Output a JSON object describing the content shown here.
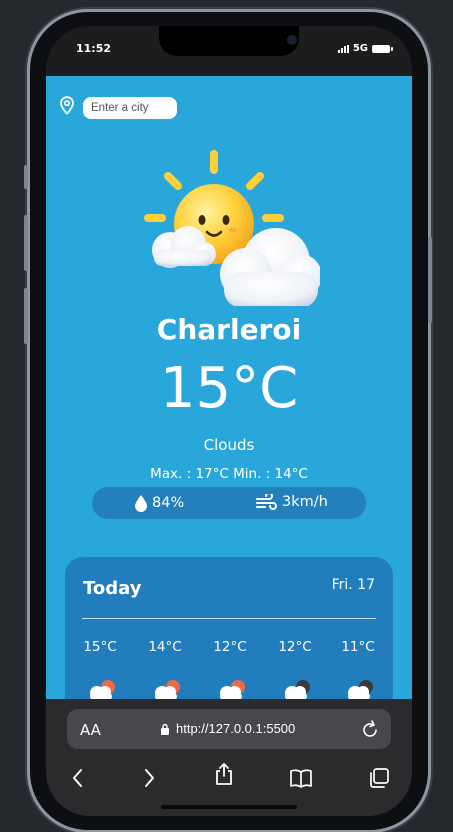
{
  "status_bar": {
    "time": "11:52",
    "network": "5G"
  },
  "search": {
    "placeholder": "Enter a city",
    "icon": "location-pin-icon"
  },
  "current": {
    "city": "Charleroi",
    "temperature": "15°C",
    "description": "Clouds",
    "max_min": "Max. : 17°C Min. : 14°C",
    "humidity": "84%",
    "wind": "3km/h",
    "weather_icon": "partly-cloudy-sun-icon"
  },
  "forecast": {
    "title": "Today",
    "date": "Fri. 17",
    "hours": [
      {
        "temp": "15°C",
        "icon": "cloud-sun-icon"
      },
      {
        "temp": "14°C",
        "icon": "cloud-sun-icon"
      },
      {
        "temp": "12°C",
        "icon": "cloud-sun-icon"
      },
      {
        "temp": "12°C",
        "icon": "cloud-moon-icon"
      },
      {
        "temp": "11°C",
        "icon": "cloud-moon-icon"
      }
    ]
  },
  "browser": {
    "text_size_label": "AA",
    "url": "http://127.0.0.1:5500"
  },
  "colors": {
    "app_background": "#29a7db",
    "stats_pill": "#2480bb",
    "forecast_card": "#227dbc"
  }
}
